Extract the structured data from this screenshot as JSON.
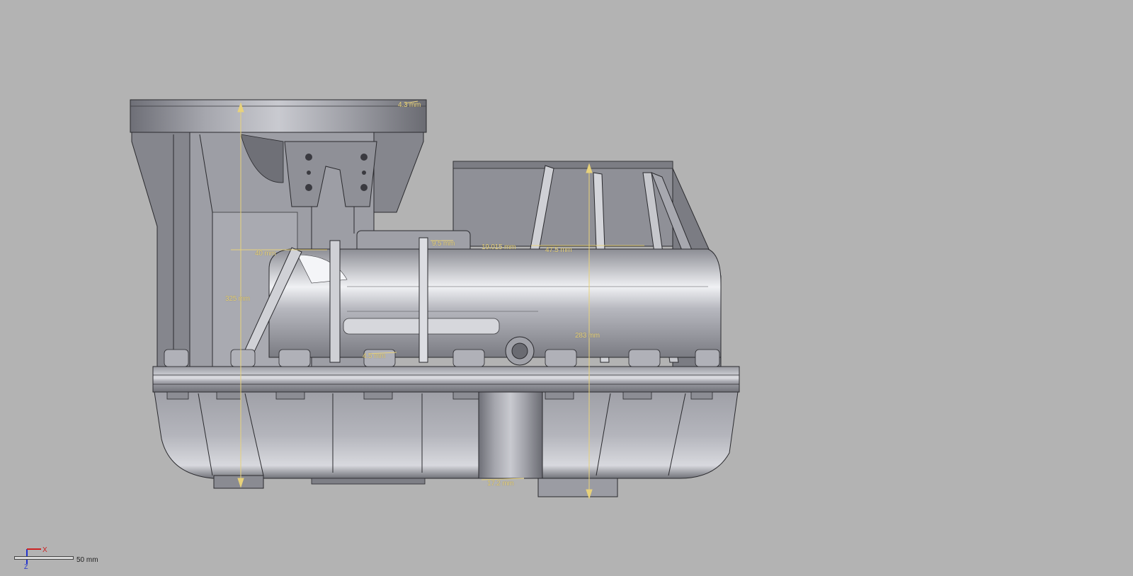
{
  "viewport": {
    "background": "#b3b3b3",
    "model_color": "#8e8f96",
    "dimension_color": "#e8d27a"
  },
  "dimensions": {
    "d1": "4.3 mm",
    "d2": "9.5 mm",
    "d3": "19.015 mm",
    "d4": "47.5 mm",
    "d5": "40 mm",
    "d6": "325 mm",
    "d7": "283 mm",
    "d8": "4.5 mm",
    "d9": "17.2 mm"
  },
  "triad": {
    "x_label": "X",
    "z_label": "Z"
  },
  "scale": {
    "label": "50 mm"
  }
}
